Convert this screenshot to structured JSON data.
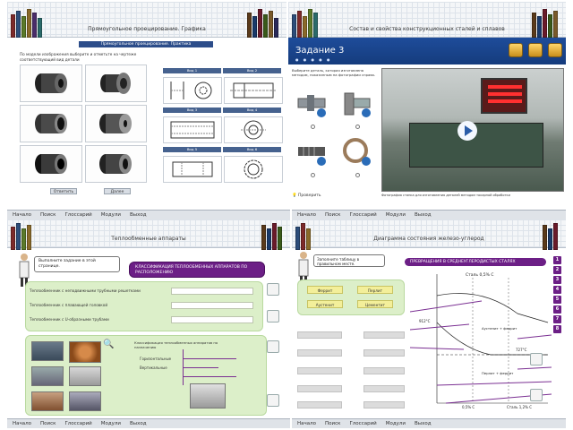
{
  "panels": [
    {
      "title": "Прямоугольное проецирование. Графика",
      "subtitle": "Прямоугольное проецирование. Практика",
      "task_text": "По модели изображения выберите и отметьте на чертеже соответствующий вид детали",
      "btn_check": "Ответить",
      "btn_next": "Далее",
      "drawing_headers": [
        "Вид 1",
        "Вид 2",
        "Вид 3",
        "Вид 4",
        "Вид 5",
        "Вид 6"
      ]
    },
    {
      "title": "Состав и свойства конструкционных сталей и сплавов",
      "task_label": "Задание 3",
      "question": "Выберите деталь, которая изготовлена методом, показанным на фотографии справа.",
      "check_label": "Проверить",
      "photo_caption": "Фотография станка для изготовления деталей методом токарной обработки"
    },
    {
      "title": "Теплообменные аппараты",
      "speech": "Выполните задание в этой странице.",
      "heading": "КЛАССИФИКАЦИЯ ТЕПЛООБМЕННЫХ АППАРАТОВ ПО РАСПОЛОЖЕНИЮ",
      "rows": [
        "Теплообменник с неподвижными трубными решетками",
        "Теплообменник с плавающей головкой",
        "Теплообменник с U-образными трубами"
      ],
      "tree_title": "Классификация теплообменных аппаратов по назначению",
      "tree_items": [
        "Горизонтальные",
        "Вертикальные"
      ]
    },
    {
      "title": "Диаграмма состояния железо-углерод",
      "speech": "Заполните таблицу в правильном месте.",
      "heading": "ПРЕВРАЩЕНИЯ В СРЕДНЕУГЛЕРОДИСТЫХ СТАЛЯХ",
      "chips": [
        "Феррит",
        "Перлит",
        "Аустенит",
        "Цементит"
      ],
      "diag_labels": {
        "top": "Сталь 0,5% С",
        "a1": "727°C",
        "a3": "912°C",
        "left": "0,5% С",
        "right": "Сталь 1,2% С",
        "ferrite": "Аустенит + феррит",
        "perlite": "Перлит + феррит"
      },
      "side_buttons": [
        "1",
        "2",
        "3",
        "4",
        "5",
        "6",
        "7",
        "8"
      ]
    }
  ],
  "nav": [
    "Начало",
    "Поиск",
    "Глоссарий",
    "Модули",
    "Выход"
  ],
  "colors": {
    "purple": "#6c1f86",
    "blue": "#1e4c9a",
    "green": "#dcefc9",
    "yellow": "#f3ef9a"
  }
}
